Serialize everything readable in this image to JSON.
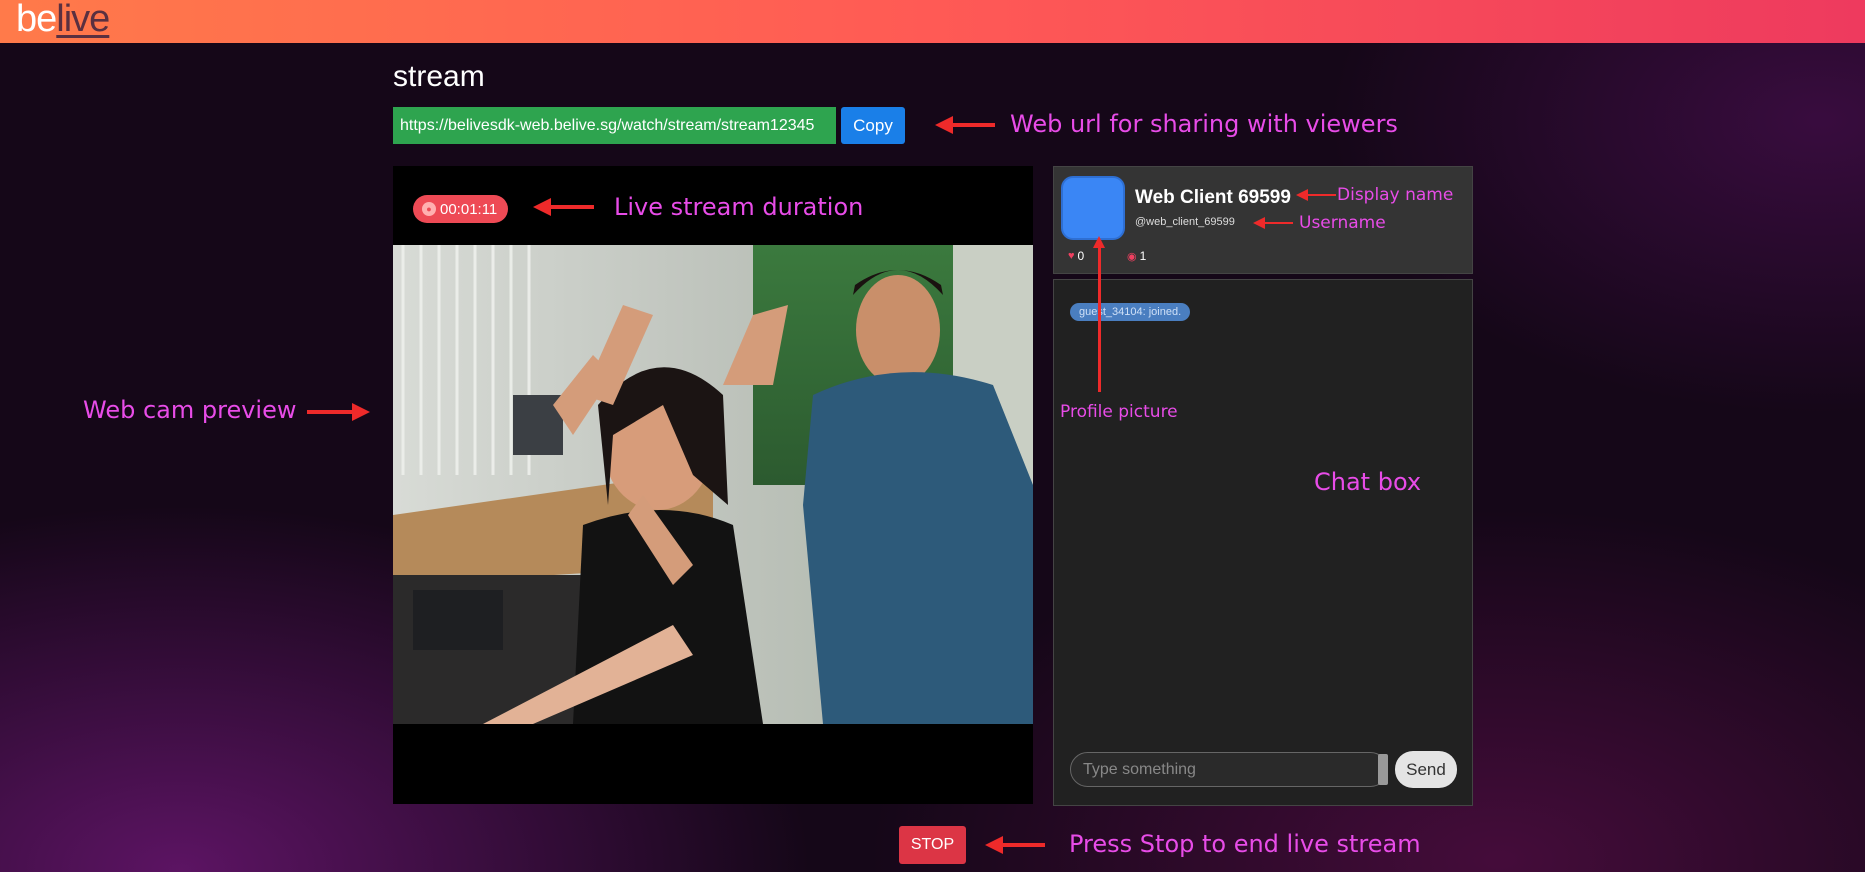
{
  "app": {
    "logo_part1": "be",
    "logo_part2": "live",
    "brand_gradient": [
      "#ff7a4a",
      "#ee3a5e"
    ]
  },
  "stream": {
    "title": "stream",
    "share_url": "https://belivesdk-web.belive.sg/watch/stream/stream12345",
    "copy_label": "Copy",
    "duration": "00:01:11",
    "stop_label": "STOP"
  },
  "profile": {
    "display_name": "Web Client 69599",
    "username": "@web_client_69599",
    "likes": "0",
    "viewers": "1"
  },
  "chat": {
    "messages": [
      "guest_34104: joined."
    ],
    "input_placeholder": "Type something",
    "send_label": "Send"
  },
  "annotations": {
    "web_url": "Web url for sharing with viewers",
    "duration": "Live stream duration",
    "display_name": "Display name",
    "username": "Username",
    "webcam": "Web cam preview",
    "profile_picture": "Profile picture",
    "chat_box": "Chat box",
    "stop": "Press Stop to end live stream"
  },
  "colors": {
    "annotation_text": "#e84ce8",
    "annotation_arrow": "#ee2a2a",
    "url_box": "#2ea44f",
    "copy_button": "#1a7fe8",
    "stop_button": "#dc3545",
    "avatar": "#3a86f5"
  },
  "icons": {
    "timer_icon": "broadcast-icon",
    "likes_icon": "heart-icon",
    "viewers_icon": "eye-icon"
  }
}
